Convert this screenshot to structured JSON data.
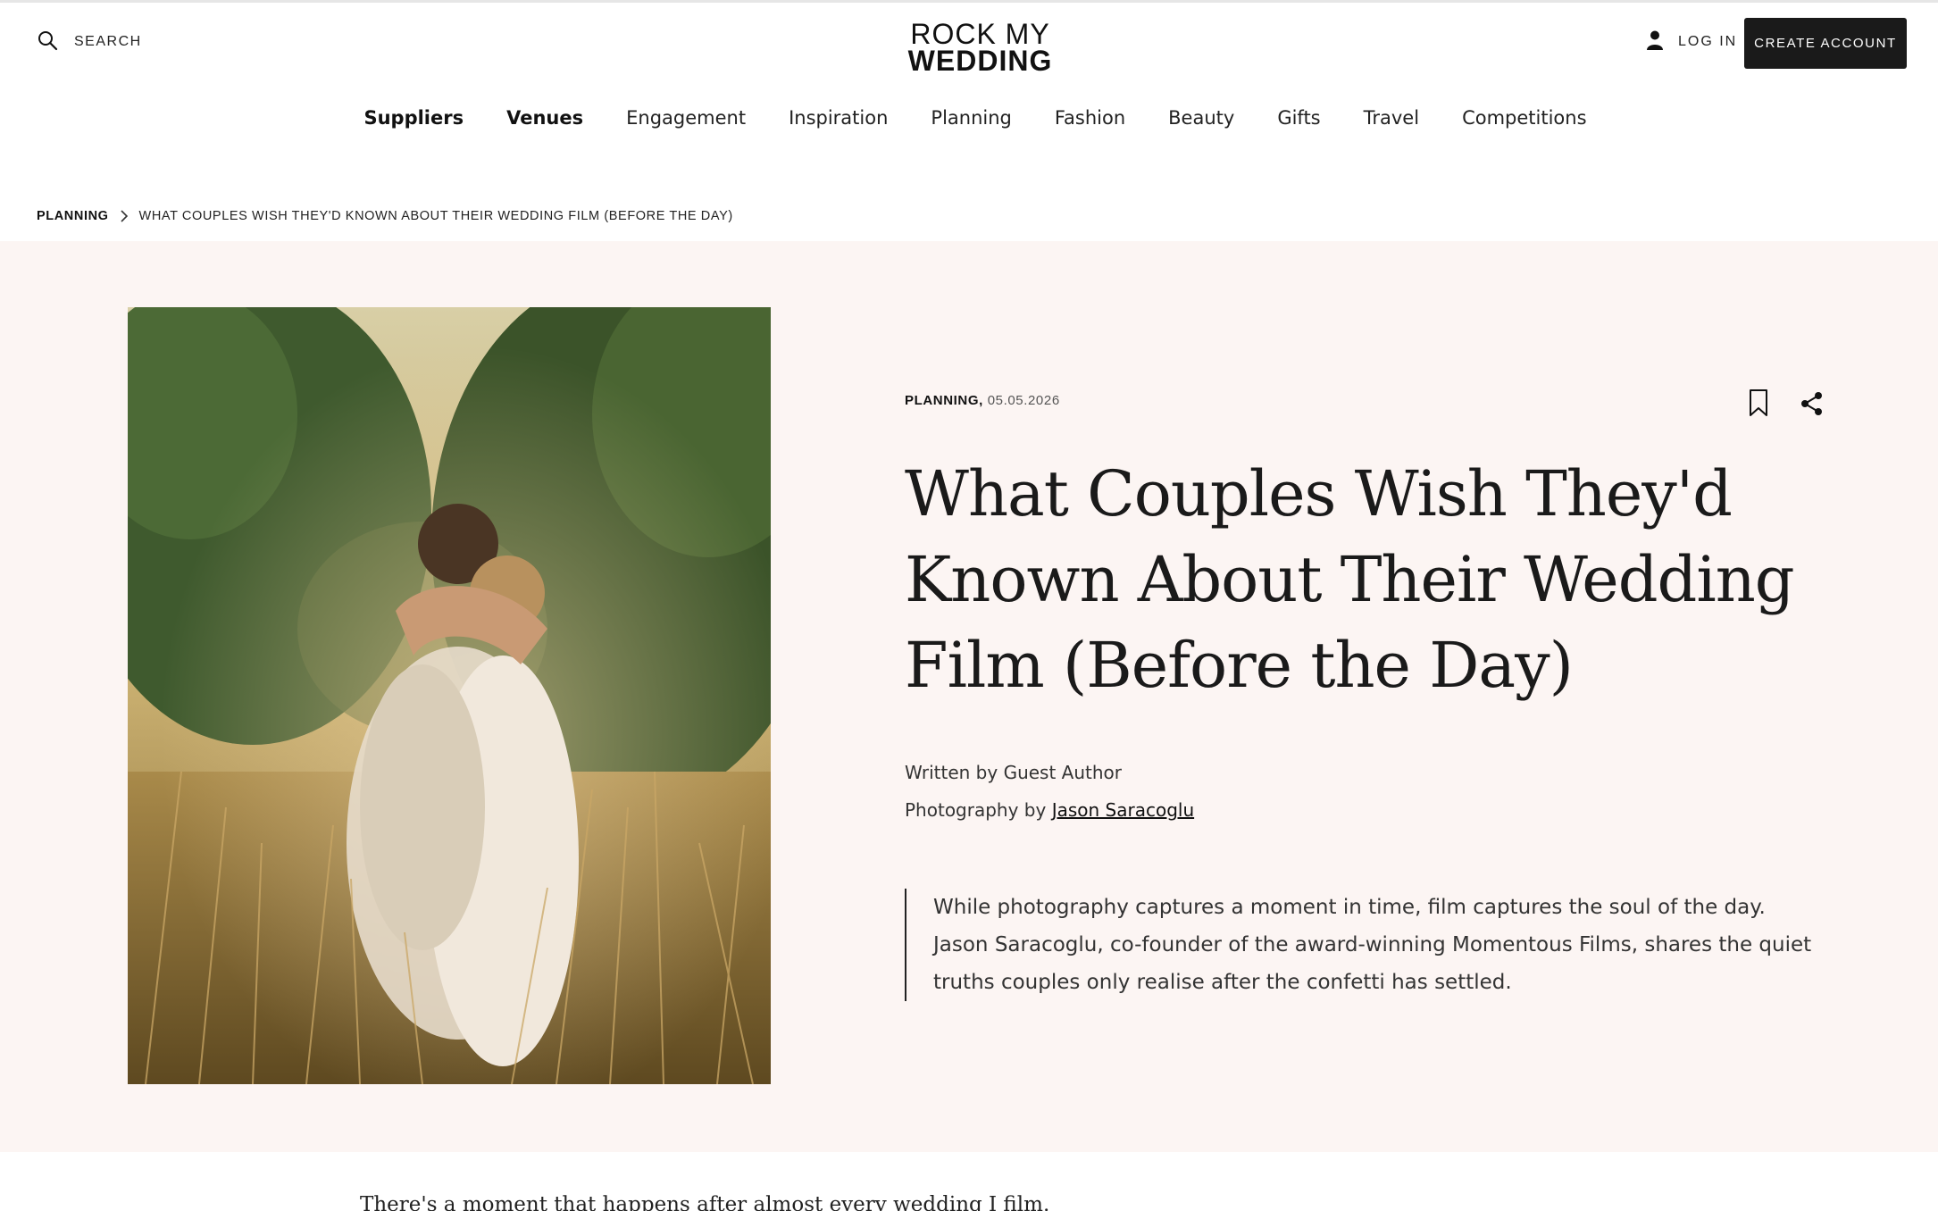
{
  "header": {
    "search_label": "Search",
    "logo_line1": "ROCK MY",
    "logo_line2": "WEDDING",
    "login_label": "Log in",
    "create_account_label": "Create account"
  },
  "nav": {
    "items": [
      {
        "label": "Suppliers",
        "bold": true
      },
      {
        "label": "Venues",
        "bold": true
      },
      {
        "label": "Engagement"
      },
      {
        "label": "Inspiration"
      },
      {
        "label": "Planning"
      },
      {
        "label": "Fashion"
      },
      {
        "label": "Beauty"
      },
      {
        "label": "Gifts"
      },
      {
        "label": "Travel"
      },
      {
        "label": "Competitions"
      }
    ]
  },
  "breadcrumb": {
    "root": "Planning",
    "current": "What Couples Wish They'd Known About Their Wedding Film (Before the Day)"
  },
  "article": {
    "category": "PLANNING,",
    "date": "05.05.2026",
    "title": "What Couples Wish They'd Known About Their Wedding Film (Before the Day)",
    "written_by": "Written by Guest Author",
    "photography_prefix": "Photography by ",
    "photographer": "Jason Saracoglu",
    "standfirst": "While photography captures a moment in time, film captures the soul of the day. Jason Saracoglu, co-founder of the award-winning Momentous Films, shares the quiet truths couples only realise after the confetti has settled.",
    "body_first_line": "There's a moment that happens after almost every wedding I film."
  },
  "icons": {
    "search": "search-icon",
    "user": "user-icon",
    "bookmark": "bookmark-icon",
    "share": "share-icon",
    "chevron": "chevron-right-icon"
  },
  "colors": {
    "hero_background": "#fcf5f3",
    "button_background": "#1a1a1a",
    "text": "#1a1a1a"
  }
}
